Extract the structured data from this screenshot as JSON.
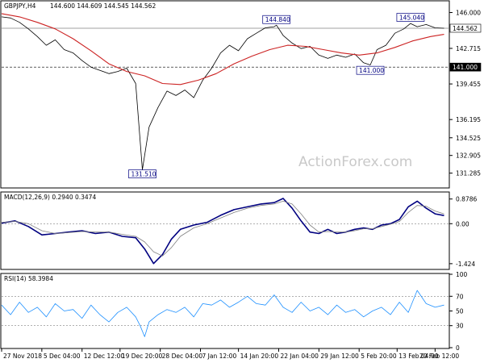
{
  "chart_data": [
    {
      "type": "line",
      "panel": "price",
      "title": "GBPJPY,H4",
      "ohlc_readout": [
        "144.600",
        "144.609",
        "144.545",
        "144.562"
      ],
      "ylim": [
        130.0,
        147.0
      ],
      "y_ticks": [
        "146.000",
        "142.715",
        "139.455",
        "136.195",
        "134.525",
        "132.905",
        "131.285"
      ],
      "y_tick_values": [
        146.0,
        142.715,
        139.455,
        136.195,
        134.525,
        132.905,
        131.285
      ],
      "current_price_label": "144.562",
      "current_price": 144.562,
      "horizontal_lines": [
        {
          "value": 144.562,
          "label": "144.562",
          "style": "solid",
          "color": "#808080"
        },
        {
          "value": 141.0,
          "label": "141.000",
          "style": "dashed",
          "color": "#000000"
        }
      ],
      "annotations": [
        {
          "label": "131.510",
          "x": 0.315,
          "value": 131.51
        },
        {
          "label": "144.840",
          "x": 0.615,
          "value": 144.84
        },
        {
          "label": "145.040",
          "x": 0.915,
          "value": 145.04
        },
        {
          "label": "141.000",
          "x": 0.825,
          "value": 141.0
        }
      ],
      "series": [
        {
          "name": "Price",
          "color": "#000000",
          "x": [
            0,
            0.02,
            0.04,
            0.06,
            0.08,
            0.1,
            0.12,
            0.14,
            0.16,
            0.18,
            0.2,
            0.22,
            0.24,
            0.26,
            0.28,
            0.3,
            0.315,
            0.33,
            0.35,
            0.37,
            0.39,
            0.41,
            0.43,
            0.45,
            0.47,
            0.49,
            0.51,
            0.53,
            0.55,
            0.57,
            0.59,
            0.61,
            0.615,
            0.63,
            0.65,
            0.67,
            0.69,
            0.71,
            0.73,
            0.75,
            0.77,
            0.79,
            0.81,
            0.825,
            0.84,
            0.86,
            0.88,
            0.9,
            0.915,
            0.93,
            0.95,
            0.97,
            0.99
          ],
          "values": [
            145.6,
            145.5,
            145.1,
            144.5,
            143.8,
            143.0,
            143.5,
            142.6,
            142.3,
            141.6,
            141.0,
            140.7,
            140.4,
            140.6,
            140.9,
            139.5,
            131.6,
            135.5,
            137.3,
            138.8,
            138.4,
            138.9,
            138.2,
            139.8,
            140.9,
            142.3,
            143.0,
            142.5,
            143.6,
            144.1,
            144.6,
            144.7,
            144.84,
            143.9,
            143.2,
            142.7,
            142.9,
            142.1,
            141.8,
            142.1,
            141.9,
            142.2,
            141.4,
            141.2,
            142.6,
            143.0,
            144.1,
            144.5,
            145.0,
            144.7,
            144.9,
            144.6,
            144.56
          ]
        },
        {
          "name": "Moving Average",
          "color": "#cc2222",
          "x": [
            0,
            0.04,
            0.08,
            0.12,
            0.16,
            0.2,
            0.24,
            0.28,
            0.32,
            0.36,
            0.4,
            0.44,
            0.48,
            0.52,
            0.56,
            0.6,
            0.64,
            0.68,
            0.72,
            0.76,
            0.8,
            0.84,
            0.88,
            0.92,
            0.96,
            0.99
          ],
          "values": [
            145.9,
            145.6,
            145.1,
            144.5,
            143.6,
            142.5,
            141.3,
            140.6,
            140.2,
            139.5,
            139.4,
            139.8,
            140.4,
            141.3,
            142.0,
            142.6,
            143.0,
            142.9,
            142.6,
            142.3,
            142.1,
            142.3,
            142.8,
            143.4,
            143.8,
            144.0
          ]
        }
      ]
    },
    {
      "type": "line",
      "panel": "macd",
      "title": "MACD(12,26,9) 0.2940 0.3474",
      "ylim": [
        -1.6,
        1.1
      ],
      "y_ticks": [
        "0.8786",
        "0.00",
        "-1.424"
      ],
      "y_tick_values": [
        0.8786,
        0.0,
        -1.424
      ],
      "series": [
        {
          "name": "MACD",
          "color": "#000080",
          "x": [
            0,
            0.03,
            0.06,
            0.09,
            0.12,
            0.15,
            0.18,
            0.21,
            0.24,
            0.27,
            0.3,
            0.32,
            0.34,
            0.36,
            0.38,
            0.4,
            0.43,
            0.46,
            0.49,
            0.52,
            0.55,
            0.58,
            0.61,
            0.63,
            0.65,
            0.67,
            0.69,
            0.71,
            0.73,
            0.75,
            0.77,
            0.79,
            0.81,
            0.83,
            0.85,
            0.87,
            0.89,
            0.91,
            0.93,
            0.95,
            0.97,
            0.99
          ],
          "values": [
            0.02,
            0.1,
            -0.1,
            -0.4,
            -0.35,
            -0.3,
            -0.25,
            -0.35,
            -0.3,
            -0.45,
            -0.5,
            -0.9,
            -1.42,
            -1.1,
            -0.55,
            -0.2,
            -0.05,
            0.05,
            0.3,
            0.5,
            0.6,
            0.7,
            0.75,
            0.9,
            0.55,
            0.1,
            -0.3,
            -0.35,
            -0.2,
            -0.35,
            -0.3,
            -0.2,
            -0.15,
            -0.2,
            -0.05,
            0.0,
            0.15,
            0.6,
            0.8,
            0.55,
            0.35,
            0.29
          ]
        },
        {
          "name": "Signal",
          "color": "#808080",
          "x": [
            0,
            0.03,
            0.06,
            0.09,
            0.12,
            0.15,
            0.18,
            0.21,
            0.24,
            0.27,
            0.3,
            0.32,
            0.34,
            0.36,
            0.38,
            0.4,
            0.43,
            0.46,
            0.49,
            0.52,
            0.55,
            0.58,
            0.61,
            0.63,
            0.65,
            0.67,
            0.69,
            0.71,
            0.73,
            0.75,
            0.77,
            0.79,
            0.81,
            0.83,
            0.85,
            0.87,
            0.89,
            0.91,
            0.93,
            0.95,
            0.97,
            0.99
          ],
          "values": [
            0.05,
            0.08,
            0.0,
            -0.25,
            -0.35,
            -0.32,
            -0.28,
            -0.3,
            -0.3,
            -0.38,
            -0.45,
            -0.65,
            -1.0,
            -1.15,
            -0.85,
            -0.45,
            -0.15,
            0.0,
            0.2,
            0.4,
            0.55,
            0.65,
            0.7,
            0.8,
            0.7,
            0.35,
            -0.05,
            -0.3,
            -0.28,
            -0.3,
            -0.3,
            -0.25,
            -0.18,
            -0.18,
            -0.1,
            -0.02,
            0.08,
            0.4,
            0.65,
            0.62,
            0.45,
            0.35
          ]
        }
      ]
    },
    {
      "type": "line",
      "panel": "rsi",
      "title": "RSI(14) 58.3984",
      "ylim": [
        0,
        100
      ],
      "y_ticks": [
        "100",
        "70",
        "50",
        "30",
        "0"
      ],
      "y_tick_values": [
        100,
        70,
        50,
        30,
        0
      ],
      "levels": [
        70,
        30
      ],
      "series": [
        {
          "name": "RSI",
          "color": "#1e90ff",
          "x": [
            0,
            0.02,
            0.04,
            0.06,
            0.08,
            0.1,
            0.12,
            0.14,
            0.16,
            0.18,
            0.2,
            0.22,
            0.24,
            0.26,
            0.28,
            0.3,
            0.31,
            0.32,
            0.33,
            0.35,
            0.37,
            0.39,
            0.41,
            0.43,
            0.45,
            0.47,
            0.49,
            0.51,
            0.53,
            0.55,
            0.57,
            0.59,
            0.61,
            0.63,
            0.65,
            0.67,
            0.69,
            0.71,
            0.73,
            0.75,
            0.77,
            0.79,
            0.81,
            0.83,
            0.85,
            0.87,
            0.89,
            0.91,
            0.93,
            0.95,
            0.97,
            0.99
          ],
          "values": [
            58,
            45,
            62,
            48,
            55,
            42,
            60,
            50,
            52,
            40,
            58,
            45,
            35,
            48,
            55,
            42,
            30,
            15,
            35,
            45,
            52,
            48,
            55,
            42,
            60,
            58,
            65,
            55,
            62,
            70,
            60,
            58,
            72,
            55,
            48,
            62,
            50,
            55,
            45,
            58,
            48,
            52,
            42,
            50,
            55,
            45,
            62,
            48,
            78,
            60,
            55,
            58
          ]
        }
      ]
    }
  ],
  "x_axis": {
    "labels": [
      "27 Nov 2018",
      "5 Dec 04:00",
      "12 Dec 12:00",
      "19 Dec 20:00",
      "28 Dec 04:00",
      "7 Jan 12:00",
      "14 Jan 20:00",
      "22 Jan 04:00",
      "29 Jan 12:00",
      "5 Feb 20:00",
      "13 Feb 04:00",
      "20 Feb 12:00"
    ],
    "positions": [
      0.0,
      0.09,
      0.18,
      0.265,
      0.355,
      0.445,
      0.53,
      0.62,
      0.71,
      0.8,
      0.885,
      0.97
    ]
  },
  "watermark": "ActionForex.com",
  "colors": {
    "price": "#000000",
    "moving_average": "#cc2222",
    "macd": "#000080",
    "signal": "#808080",
    "rsi": "#1e90ff",
    "grid": "#808080"
  }
}
